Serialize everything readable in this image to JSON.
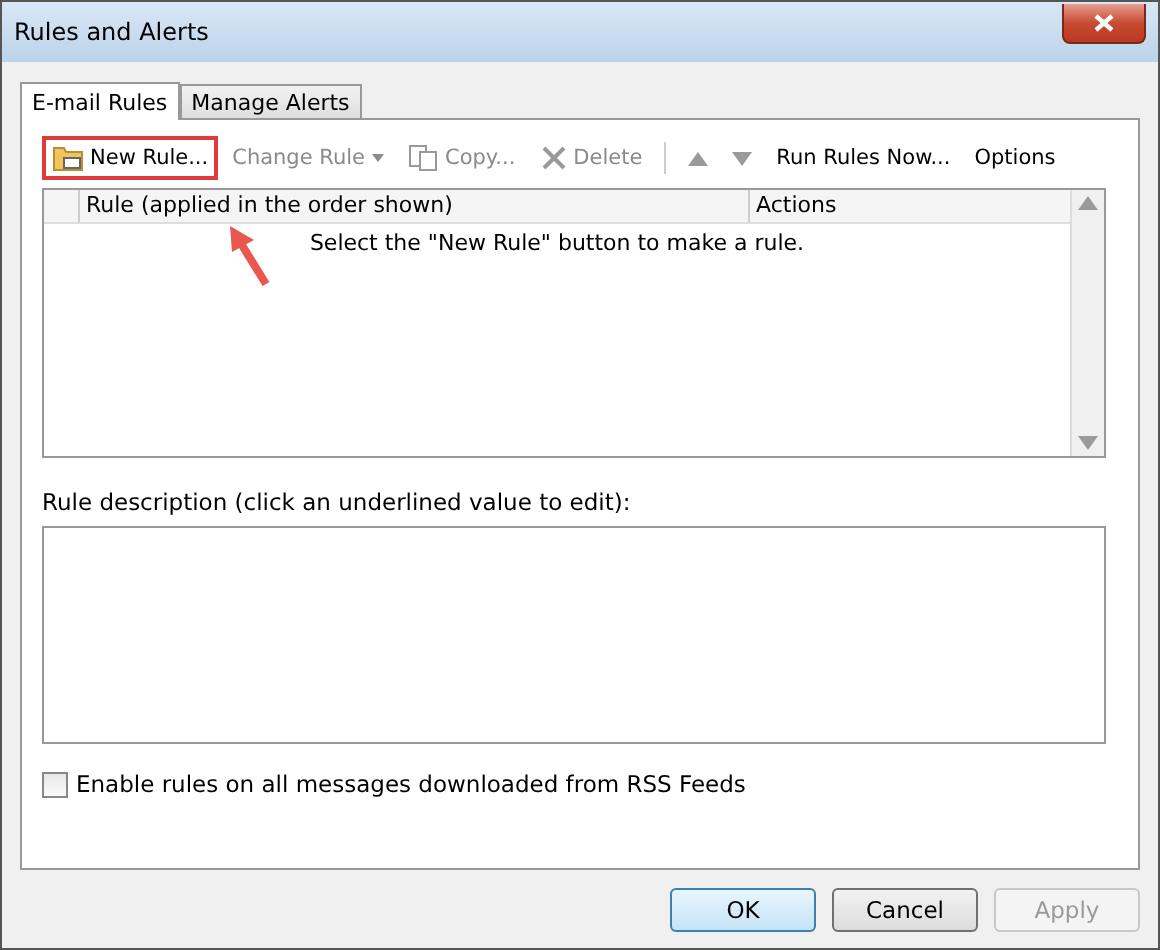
{
  "window": {
    "title": "Rules and Alerts"
  },
  "tabs": [
    {
      "label": "E-mail Rules",
      "selected": true
    },
    {
      "label": "Manage Alerts",
      "selected": false
    }
  ],
  "toolbar": [
    {
      "kind": "button",
      "label": "New Rule...",
      "disabled": false,
      "highlighted": true
    },
    {
      "kind": "dropdown",
      "label": "Change Rule",
      "disabled": true,
      "highlighted": false
    },
    {
      "kind": "button",
      "label": "Copy...",
      "disabled": true,
      "highlighted": false
    },
    {
      "kind": "button",
      "label": "Delete",
      "disabled": true,
      "highlighted": false
    },
    {
      "kind": "separator"
    },
    {
      "kind": "arrow",
      "disabled": true
    },
    {
      "kind": "arrow",
      "disabled": true
    },
    {
      "kind": "button",
      "label": "Run Rules Now...",
      "disabled": false,
      "highlighted": false
    },
    {
      "kind": "button",
      "label": "Options",
      "disabled": false,
      "highlighted": false
    }
  ],
  "table": {
    "columns": [
      "Rule (applied in the order shown)",
      "Actions"
    ],
    "empty_message": "Select the \"New Rule\" button to make a rule."
  },
  "description": {
    "label": "Rule description (click an underlined value to edit):"
  },
  "rss_checkbox": {
    "label": "Enable rules on all messages downloaded from RSS Feeds",
    "checked": false
  },
  "buttons": [
    {
      "label": "OK",
      "default": true,
      "disabled": false
    },
    {
      "label": "Cancel",
      "default": false,
      "disabled": false
    },
    {
      "label": "Apply",
      "default": false,
      "disabled": true
    }
  ]
}
